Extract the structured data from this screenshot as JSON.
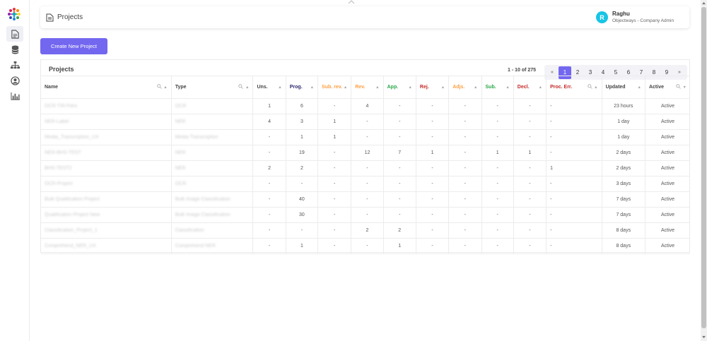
{
  "header": {
    "title": "Projects",
    "user_name": "Raghu",
    "user_role": "Objectways - Company Admin",
    "avatar_initial": "R"
  },
  "actions": {
    "create_label": "Create New Project"
  },
  "table": {
    "title": "Projects",
    "range_label": "1 - 10 of 275",
    "pagination": {
      "prev": "«",
      "pages": [
        "1",
        "2",
        "3",
        "4",
        "5",
        "6",
        "7",
        "8",
        "9"
      ],
      "current": "1",
      "next": "»"
    },
    "columns": [
      {
        "label": "Name"
      },
      {
        "label": "Type"
      },
      {
        "label": "Uns."
      },
      {
        "label": "Prog."
      },
      {
        "label": "Sub. rev."
      },
      {
        "label": "Rev."
      },
      {
        "label": "App."
      },
      {
        "label": "Rej."
      },
      {
        "label": "Adjs."
      },
      {
        "label": "Sub."
      },
      {
        "label": "Decl."
      },
      {
        "label": "Proc. Err."
      },
      {
        "label": "Updated"
      },
      {
        "label": "Active"
      }
    ],
    "rows": [
      {
        "name": "OCR-TIR-Files",
        "type": "OCR",
        "uns": "1",
        "prog": "6",
        "subrev": "-",
        "rev": "4",
        "app": "-",
        "rej": "-",
        "adj": "-",
        "sub": "-",
        "decl": "-",
        "perr": "-",
        "updated": "23 hours",
        "active": "Active"
      },
      {
        "name": "NER-Label",
        "type": "NER",
        "uns": "4",
        "prog": "3",
        "subrev": "1",
        "rev": "-",
        "app": "-",
        "rej": "-",
        "adj": "-",
        "sub": "-",
        "decl": "-",
        "perr": "-",
        "updated": "1 day",
        "active": "Active"
      },
      {
        "name": "Media_Transcription_UX",
        "type": "Media Transcription",
        "uns": "-",
        "prog": "1",
        "subrev": "1",
        "rev": "-",
        "app": "-",
        "rej": "-",
        "adj": "-",
        "sub": "-",
        "decl": "-",
        "perr": "-",
        "updated": "1 day",
        "active": "Active"
      },
      {
        "name": "NER-BHS-TEST",
        "type": "NER",
        "uns": "-",
        "prog": "19",
        "subrev": "-",
        "rev": "12",
        "app": "7",
        "rej": "1",
        "adj": "-",
        "sub": "1",
        "decl": "1",
        "perr": "-",
        "updated": "2 days",
        "active": "Active"
      },
      {
        "name": "BHS-TEST2",
        "type": "NER",
        "uns": "2",
        "prog": "2",
        "subrev": "-",
        "rev": "-",
        "app": "-",
        "rej": "-",
        "adj": "-",
        "sub": "-",
        "decl": "-",
        "perr": "1",
        "updated": "2 days",
        "active": "Active"
      },
      {
        "name": "OCR-Project",
        "type": "OCR",
        "uns": "-",
        "prog": "-",
        "subrev": "-",
        "rev": "-",
        "app": "-",
        "rej": "-",
        "adj": "-",
        "sub": "-",
        "decl": "-",
        "perr": "-",
        "updated": "3 days",
        "active": "Active"
      },
      {
        "name": "Bulk Qualification Project",
        "type": "Bulk Image Classification",
        "uns": "-",
        "prog": "40",
        "subrev": "-",
        "rev": "-",
        "app": "-",
        "rej": "-",
        "adj": "-",
        "sub": "-",
        "decl": "-",
        "perr": "-",
        "updated": "7 days",
        "active": "Active"
      },
      {
        "name": "Qualification Project New",
        "type": "Bulk Image Classification",
        "uns": "-",
        "prog": "30",
        "subrev": "-",
        "rev": "-",
        "app": "-",
        "rej": "-",
        "adj": "-",
        "sub": "-",
        "decl": "-",
        "perr": "-",
        "updated": "7 days",
        "active": "Active"
      },
      {
        "name": "Classification_Project_1",
        "type": "Classification",
        "uns": "-",
        "prog": "-",
        "subrev": "-",
        "rev": "2",
        "app": "2",
        "rej": "-",
        "adj": "-",
        "sub": "-",
        "decl": "-",
        "perr": "-",
        "updated": "8 days",
        "active": "Active"
      },
      {
        "name": "Comprehend_NER_UX",
        "type": "Comprehend NER",
        "uns": "-",
        "prog": "1",
        "subrev": "-",
        "rev": "-",
        "app": "1",
        "rej": "-",
        "adj": "-",
        "sub": "-",
        "decl": "-",
        "perr": "-",
        "updated": "8 days",
        "active": "Active"
      }
    ]
  },
  "sidebar": {
    "icons": [
      "document-icon",
      "database-icon",
      "sitemap-icon",
      "user-circle-icon",
      "bar-chart-icon"
    ]
  },
  "colors": {
    "accent": "#7367f0",
    "avatar": "#19c4e6",
    "orange": "#ff9f43",
    "green": "#28a745",
    "red": "#c62828"
  }
}
